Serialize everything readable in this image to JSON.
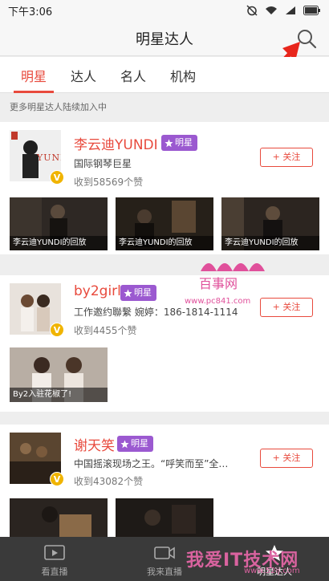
{
  "status_bar": {
    "time": "下午3:06"
  },
  "nav": {
    "title": "明星达人"
  },
  "tabs": [
    {
      "label": "明星",
      "active": true
    },
    {
      "label": "达人",
      "active": false
    },
    {
      "label": "名人",
      "active": false
    },
    {
      "label": "机构",
      "active": false
    }
  ],
  "notice": "更多明星达人陆续加入中",
  "cards": [
    {
      "name": "李云迪YUNDI",
      "badge": "明星",
      "verify_mark": "V",
      "description": "国际钢琴巨星",
      "likes": "收到58569个赞",
      "follow_label": "+ 关注",
      "avatar_text": "YUNDI",
      "videos": [
        "李云迪YUNDI的回放",
        "李云迪YUNDI的回放",
        "李云迪YUNDI的回放"
      ]
    },
    {
      "name": "by2girl",
      "badge": "明星",
      "verify_mark": "V",
      "description": "工作邀约聯繫 婉婷：186-1814-1114",
      "likes": "收到4455个赞",
      "follow_label": "+ 关注",
      "videos": [
        "By2入驻花椒了!"
      ]
    },
    {
      "name": "谢天笑",
      "badge": "明星",
      "verify_mark": "V",
      "description": "中国摇滚现场之王。“呼笑而至”全…",
      "likes": "收到43082个赞",
      "follow_label": "+ 关注",
      "videos": [
        "",
        ""
      ]
    }
  ],
  "watermark": {
    "text": "百事网",
    "url": "www.pc841.com"
  },
  "bottom_nav": [
    {
      "label": "看直播",
      "icon": "tv-icon",
      "active": false
    },
    {
      "label": "我来直播",
      "icon": "camera-icon",
      "active": false
    },
    {
      "label": "明星达人",
      "icon": "star-icon",
      "active": true
    }
  ],
  "bottom_watermark": {
    "text": "我爱IT技术网",
    "url": "www.52ij.com"
  },
  "colors": {
    "accent": "#e84a3d",
    "badge": "#9b59d0",
    "verify": "#f0b400",
    "bottom_bar": "#3a3a3a"
  }
}
